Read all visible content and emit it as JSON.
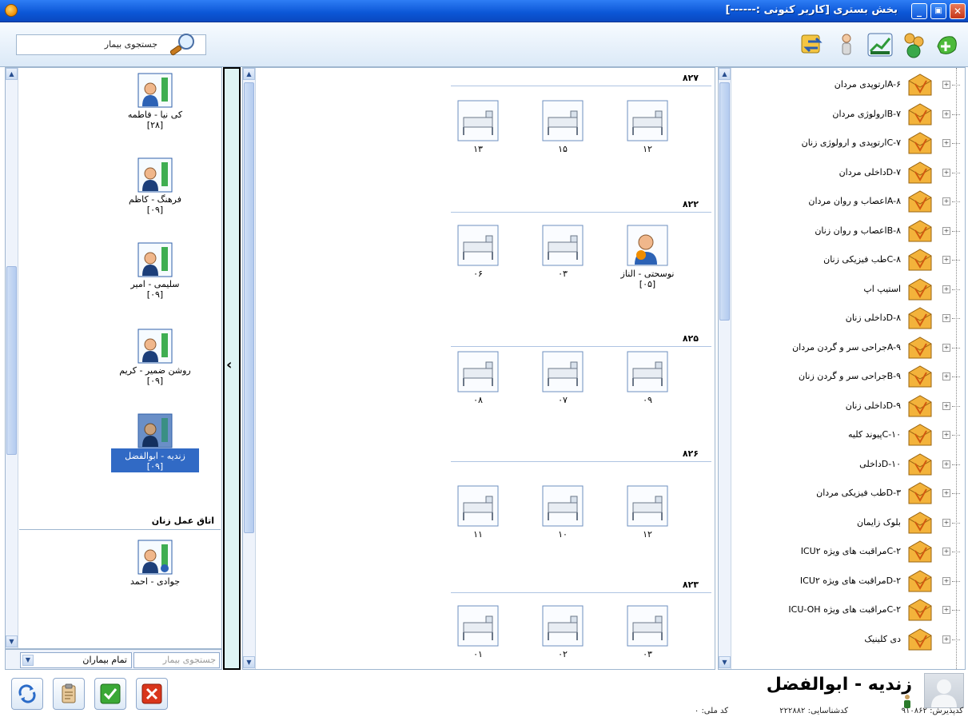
{
  "window": {
    "title": "بخش بستری [کاربر کنونی :------]",
    "min_label": "_",
    "max_label": "▣",
    "close_label": "✕"
  },
  "toolbar": {
    "search_label": "جستجوی بیمار",
    "icons": [
      "add-icon",
      "patients-icon",
      "chart-icon",
      "person-icon",
      "transfer-icon"
    ]
  },
  "patients": [
    {
      "name": "کی نیا - فاطمه",
      "num": "[۲۸]"
    },
    {
      "name": "فرهنگ - کاظم",
      "num": "[۰۹]"
    },
    {
      "name": "سلیمی - امیر",
      "num": "[۰۹]"
    },
    {
      "name": "روشن ضمیر - کریم",
      "num": "[۰۹]"
    },
    {
      "name": "زندیه - ابوالفضل",
      "num": "[۰۹]"
    }
  ],
  "room_section": {
    "title": "اتاق عمل زنان",
    "patient": {
      "name": "جوادی - احمد"
    }
  },
  "filter": {
    "select_value": "تمام بیماران",
    "search_placeholder": "جستجوی بیمار"
  },
  "rooms": [
    {
      "title": "۸۲۷",
      "beds": [
        "۱۲",
        "۱۵",
        "۱۳"
      ]
    },
    {
      "title": "۸۲۲",
      "beds": [
        "نوسحتی - الناز",
        "۰۳",
        "۰۶"
      ],
      "occupied_num": "[۰۵]"
    },
    {
      "title": "۸۲۵",
      "beds": [
        "۰۹",
        "۰۷",
        "۰۸"
      ]
    },
    {
      "title": "۸۲۶",
      "beds": [
        "۱۲",
        "۱۰",
        "۱۱"
      ]
    },
    {
      "title": "۸۲۳",
      "beds": [
        "۰۳",
        "۰۲",
        "۰۱"
      ]
    }
  ],
  "wards": [
    "A-۶ارتوپدی مردان",
    "B-۷ارولوژی مردان",
    "C-۷ارتوپدی و ارولوژی زنان",
    "D-۷داخلی مردان",
    "A-۸اعصاب و روان مردان",
    "B-۸اعصاب و روان زنان",
    "C-۸طب فیزیکی زنان",
    "استیپ اپ",
    "D-۸داخلی زنان",
    "A-۹جراحی سر و گردن مردان",
    "B-۹جراحی سر و گردن زنان",
    "D-۹داخلی زنان",
    "C-۱۰پیوند کلیه",
    "D-۱۰داخلی",
    "D-۳طب فیزیکی مردان",
    "بلوک زایمان",
    "C-۲مراقبت های ویژه ICU۲",
    "D-۲مراقبت های ویژه ICU۲",
    "C-۲مراقبت های ویژه ICU-OH",
    "دی کلینیک"
  ],
  "current_patient": {
    "name": "زندیه - ابوالفضل",
    "admission_label": "کدپذیرش:",
    "admission_value": "۹۱۰۸۶۲",
    "identifier_label": "کدشناسایی:",
    "identifier_value": "۲۲۲۸۸۲",
    "national_label": "کد ملی:",
    "national_value": "۰"
  },
  "actions": [
    "refresh-icon",
    "clipboard-icon",
    "check-icon",
    "cancel-icon"
  ],
  "colors": {
    "titlebar": "#0b56d6",
    "selection": "#316ac5",
    "panel_border": "#9fb6cf",
    "strip": "#dff4f4"
  }
}
